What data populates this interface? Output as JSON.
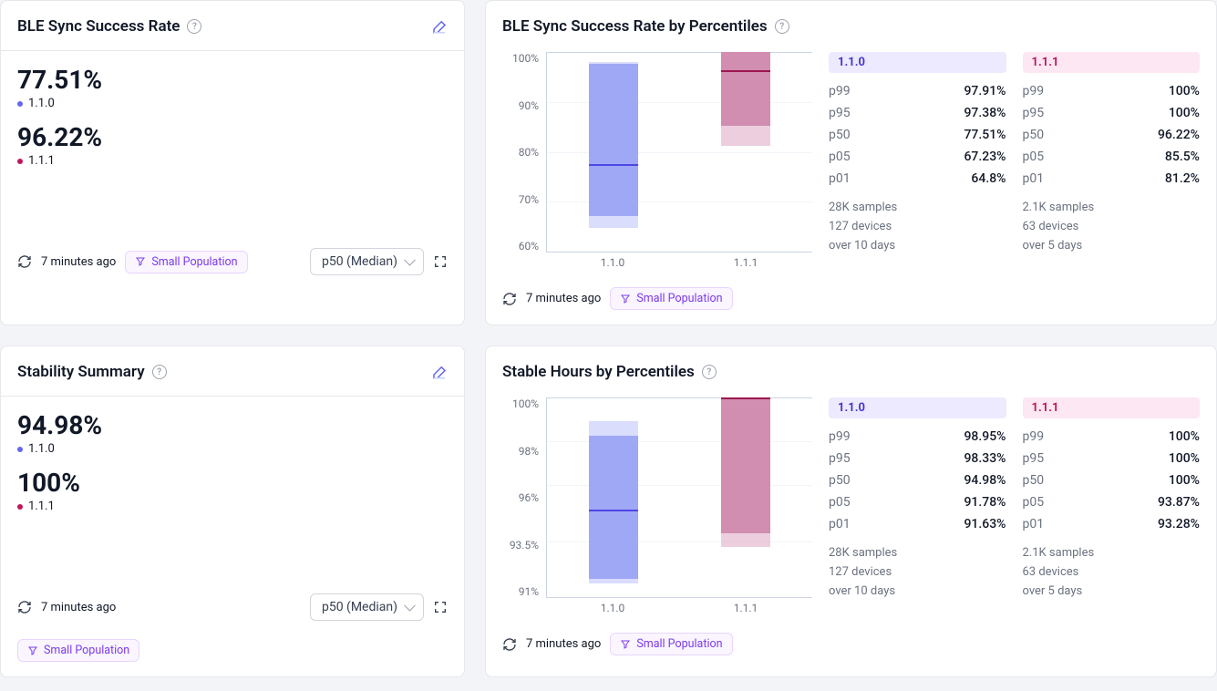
{
  "common": {
    "timeago": "7 minutes ago",
    "smallPop": "Small Population",
    "selectMedian": "p50 (Median)"
  },
  "versions": {
    "v110": "1.1.0",
    "v111": "1.1.1"
  },
  "card_ble": {
    "title": "BLE Sync Success Rate",
    "val110": "77.51%",
    "val111": "96.22%"
  },
  "card_stab": {
    "title": "Stability Summary",
    "val110": "94.98%",
    "val111": "100%"
  },
  "perc_ble": {
    "title": "BLE Sync Success Rate by Percentiles",
    "yticks": [
      "100%",
      "90%",
      "80%",
      "70%",
      "60%"
    ],
    "cols": [
      {
        "ver": "1.1.0",
        "class": "blue",
        "rows": [
          [
            "p99",
            "97.91%"
          ],
          [
            "p95",
            "97.38%"
          ],
          [
            "p50",
            "77.51%"
          ],
          [
            "p05",
            "67.23%"
          ],
          [
            "p01",
            "64.8%"
          ]
        ],
        "meta": [
          "28K samples",
          "127 devices",
          "over 10 days"
        ]
      },
      {
        "ver": "1.1.1",
        "class": "pink",
        "rows": [
          [
            "p99",
            "100%"
          ],
          [
            "p95",
            "100%"
          ],
          [
            "p50",
            "96.22%"
          ],
          [
            "p05",
            "85.5%"
          ],
          [
            "p01",
            "81.2%"
          ]
        ],
        "meta": [
          "2.1K samples",
          "63 devices",
          "over 5 days"
        ]
      }
    ]
  },
  "perc_stab": {
    "title": "Stable Hours by Percentiles",
    "yticks": [
      "100%",
      "98%",
      "96%",
      "93.5%",
      "91%"
    ],
    "cols": [
      {
        "ver": "1.1.0",
        "class": "blue",
        "rows": [
          [
            "p99",
            "98.95%"
          ],
          [
            "p95",
            "98.33%"
          ],
          [
            "p50",
            "94.98%"
          ],
          [
            "p05",
            "91.78%"
          ],
          [
            "p01",
            "91.63%"
          ]
        ],
        "meta": [
          "28K samples",
          "127 devices",
          "over 10 days"
        ]
      },
      {
        "ver": "1.1.1",
        "class": "pink",
        "rows": [
          [
            "p99",
            "100%"
          ],
          [
            "p95",
            "100%"
          ],
          [
            "p50",
            "100%"
          ],
          [
            "p05",
            "93.87%"
          ],
          [
            "p01",
            "93.28%"
          ]
        ],
        "meta": [
          "2.1K samples",
          "63 devices",
          "over 5 days"
        ]
      }
    ]
  },
  "chart_data": [
    {
      "type": "boxplot",
      "title": "BLE Sync Success Rate by Percentiles",
      "ylabel": "%",
      "ylim": [
        60,
        100
      ],
      "categories": [
        "1.1.0",
        "1.1.1"
      ],
      "series": [
        {
          "name": "1.1.0",
          "p01": 64.8,
          "p05": 67.23,
          "p50": 77.51,
          "p95": 97.38,
          "p99": 97.91
        },
        {
          "name": "1.1.1",
          "p01": 81.2,
          "p05": 85.5,
          "p50": 96.22,
          "p95": 100,
          "p99": 100
        }
      ]
    },
    {
      "type": "boxplot",
      "title": "Stable Hours by Percentiles",
      "ylabel": "%",
      "ylim": [
        91,
        100
      ],
      "categories": [
        "1.1.0",
        "1.1.1"
      ],
      "series": [
        {
          "name": "1.1.0",
          "p01": 91.63,
          "p05": 91.78,
          "p50": 94.98,
          "p95": 98.33,
          "p99": 98.95
        },
        {
          "name": "1.1.1",
          "p01": 93.28,
          "p05": 93.87,
          "p50": 100,
          "p95": 100,
          "p99": 100
        }
      ]
    }
  ]
}
